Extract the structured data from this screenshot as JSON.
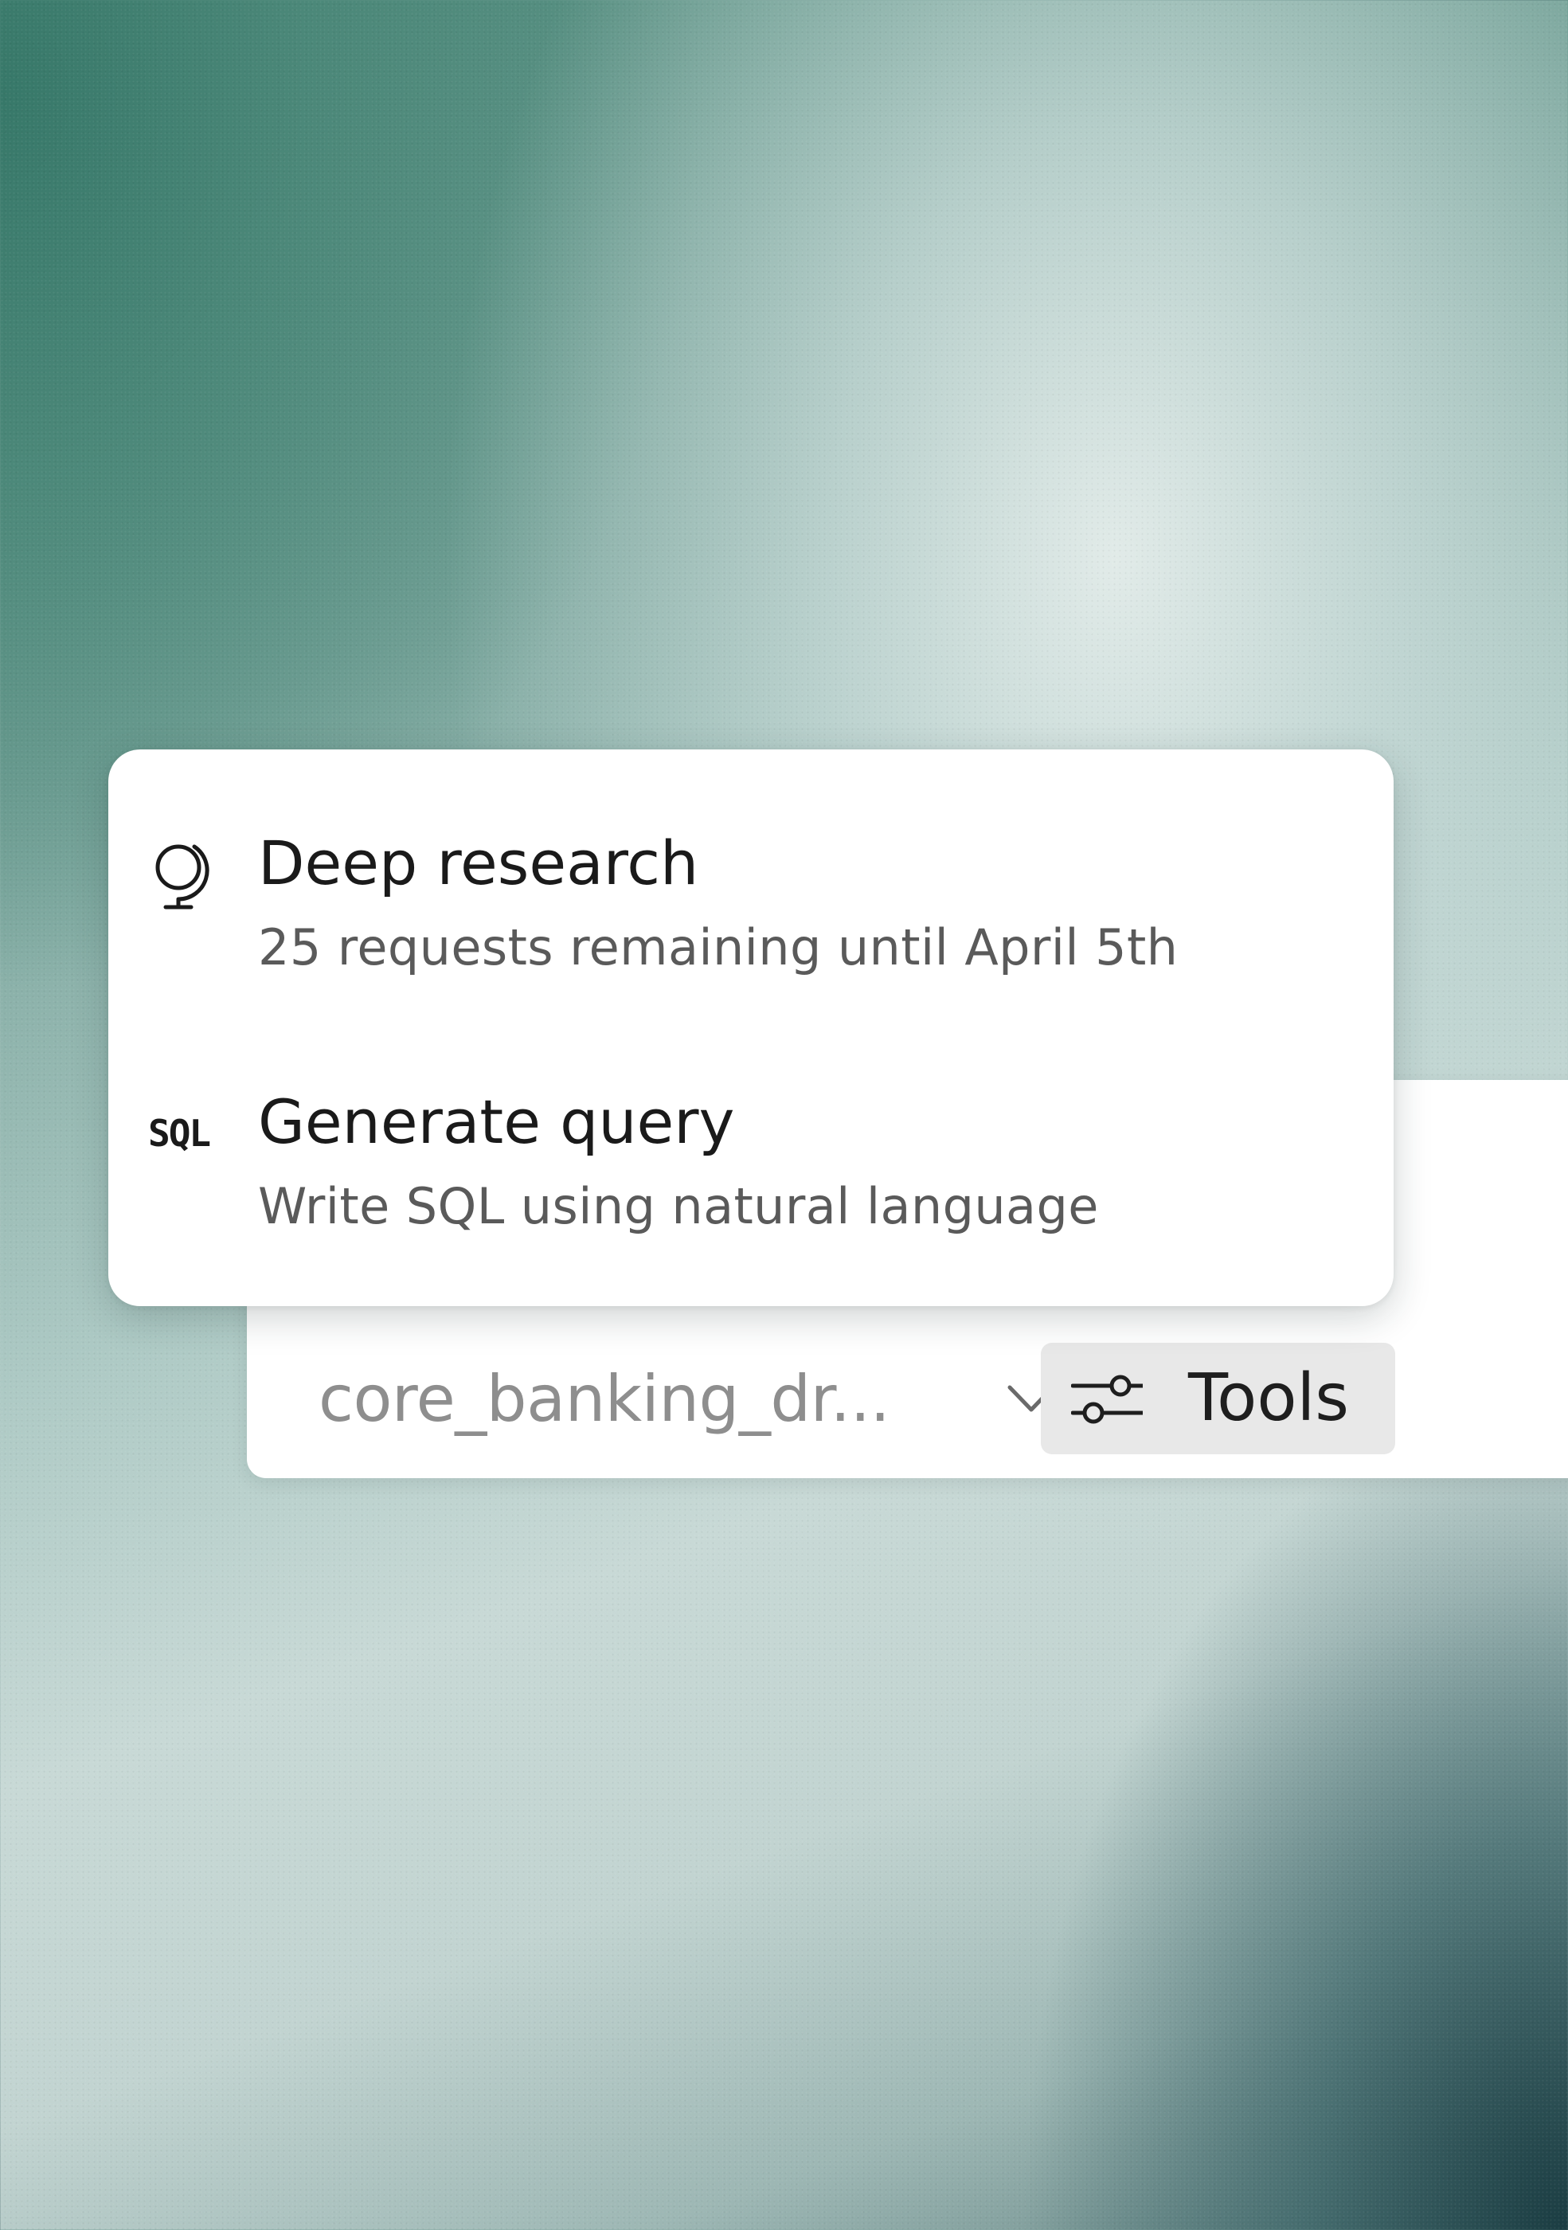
{
  "composer": {
    "database_select": {
      "value": "core_banking_dr..."
    },
    "tools_button": {
      "label": "Tools"
    }
  },
  "tools_menu": {
    "items": [
      {
        "icon": "globe-icon",
        "title": "Deep research",
        "description": "25 requests remaining until April 5th"
      },
      {
        "icon": "sql-icon",
        "icon_text": "SQL",
        "title": "Generate query",
        "description": "Write SQL using natural language"
      }
    ]
  },
  "colors": {
    "menu_background": "#ffffff",
    "tools_button_background": "#e8e8e8",
    "primary_text": "#1a1a1a",
    "secondary_text": "#5a5a5a",
    "placeholder_text": "#8e8e8e"
  }
}
